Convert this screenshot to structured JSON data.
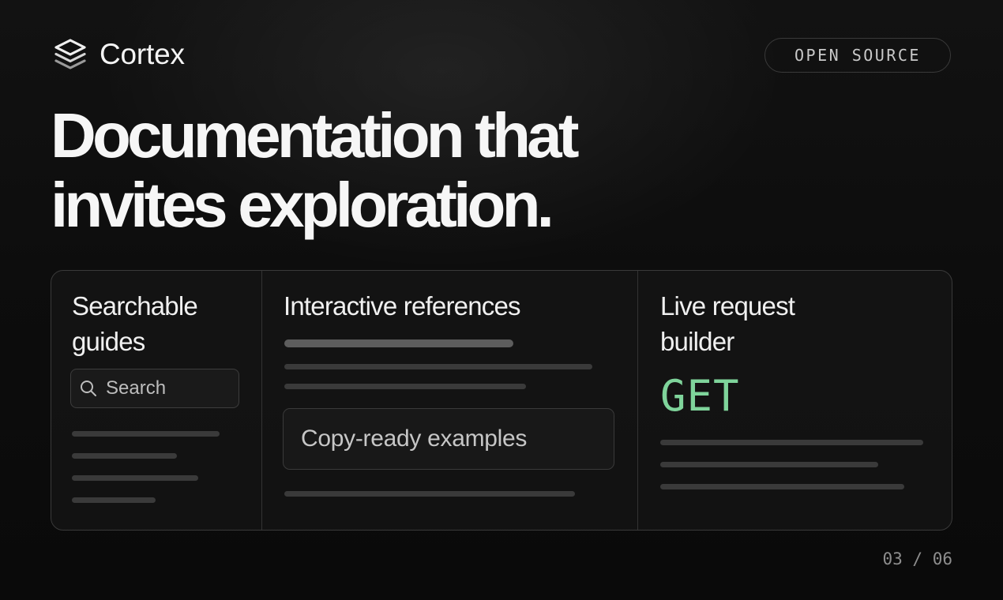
{
  "brand": {
    "name": "Cortex",
    "icon": "layers-icon"
  },
  "badge": "OPEN SOURCE",
  "headline": {
    "line1": "Documentation that",
    "line2": "invites exploration."
  },
  "features": {
    "guides": {
      "title": "Searchable guides",
      "search_placeholder": "Search",
      "search_icon": "search-icon"
    },
    "references": {
      "title": "Interactive references",
      "callout": "Copy-ready examples"
    },
    "builder": {
      "title": "Live request builder",
      "method": "GET",
      "method_color": "#7fd49b"
    }
  },
  "pager": "03 / 06",
  "colors": {
    "background": "#0b0b0b",
    "text": "#f6f6f6",
    "accent": "#7fd49b",
    "border": "#3a3a3a"
  }
}
